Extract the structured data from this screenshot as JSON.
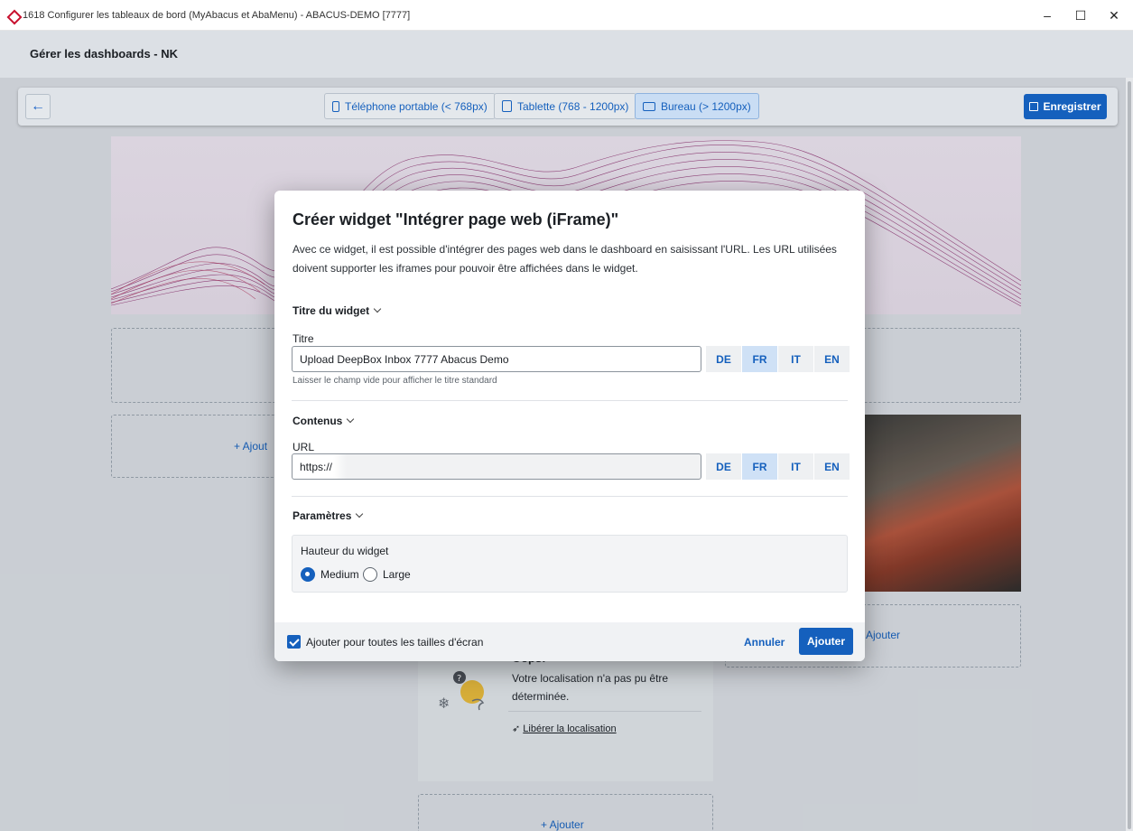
{
  "window": {
    "title": "1618 Configurer les tableaux de bord (MyAbacus et AbaMenu) - ABACUS-DEMO [7777]",
    "controls": {
      "minimize": "–",
      "maximize": "☐",
      "close": "✕"
    }
  },
  "header": {
    "title": "Gérer les dashboards - NK"
  },
  "toolbar": {
    "back_icon": "←",
    "devices": [
      {
        "label": "Téléphone portable (< 768px)",
        "icon": "mobile-icon"
      },
      {
        "label": "Tablette (768 - 1200px)",
        "icon": "tablet-icon"
      },
      {
        "label": "Bureau (> 1200px)",
        "icon": "desktop-icon",
        "active": true
      }
    ],
    "save_label": "Enregistrer"
  },
  "background": {
    "add_label": "+ Ajouter",
    "add_label_partial_left": "+ Ajout",
    "add_label_partial_right": "Ajouter",
    "weather": {
      "title": "Oops!",
      "message": "Votre localisation n'a pas pu être déterminée.",
      "link": "Libérer la localisation"
    }
  },
  "modal": {
    "title": "Créer widget \"Intégrer page web (iFrame)\"",
    "description": "Avec ce widget, il est possible d'intégrer des pages web dans le dashboard en saisissant l'URL. Les URL utilisées doivent supporter les iframes pour pouvoir être affichées dans le widget.",
    "title_section": {
      "heading": "Titre du widget",
      "field_label": "Titre",
      "value": "Upload DeepBox Inbox 7777 Abacus Demo",
      "hint": "Laisser le champ vide pour afficher le titre standard",
      "languages": [
        "DE",
        "FR",
        "IT",
        "EN"
      ],
      "active_language": "FR"
    },
    "content_section": {
      "heading": "Contenus",
      "field_label": "URL",
      "value": "https://",
      "languages": [
        "DE",
        "FR",
        "IT",
        "EN"
      ],
      "active_language": "FR"
    },
    "params_section": {
      "heading": "Paramètres",
      "height_label": "Hauteur du widget",
      "options": [
        "Medium",
        "Large"
      ],
      "selected": "Medium"
    },
    "footer": {
      "checkbox_label": "Ajouter pour toutes les tailles d'écran",
      "checkbox_checked": true,
      "cancel_label": "Annuler",
      "add_label": "Ajouter"
    }
  },
  "colors": {
    "accent": "#1560bd",
    "banner_wave": "#8a2a6a"
  }
}
